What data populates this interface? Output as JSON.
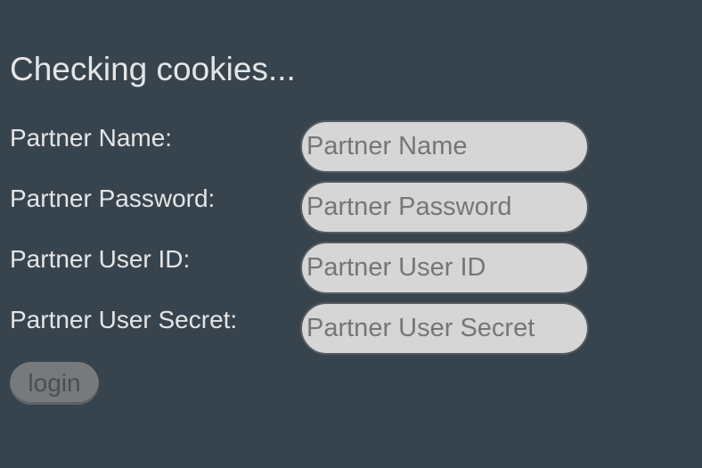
{
  "status": {
    "heading": "Checking cookies..."
  },
  "form": {
    "fields": [
      {
        "label": "Partner Name:",
        "placeholder": "Partner Name",
        "value": ""
      },
      {
        "label": "Partner Password:",
        "placeholder": "Partner Password",
        "value": ""
      },
      {
        "label": "Partner User ID:",
        "placeholder": "Partner User ID",
        "value": ""
      },
      {
        "label": "Partner User Secret:",
        "placeholder": "Partner User Secret",
        "value": ""
      }
    ],
    "login_label": "login",
    "login_disabled": true
  },
  "colors": {
    "background": "#38444d",
    "text": "#e3e5e7",
    "input_fill": "#d6d6d6",
    "input_border": "#555b60",
    "placeholder": "#767676",
    "button_disabled": "#777a7c"
  }
}
